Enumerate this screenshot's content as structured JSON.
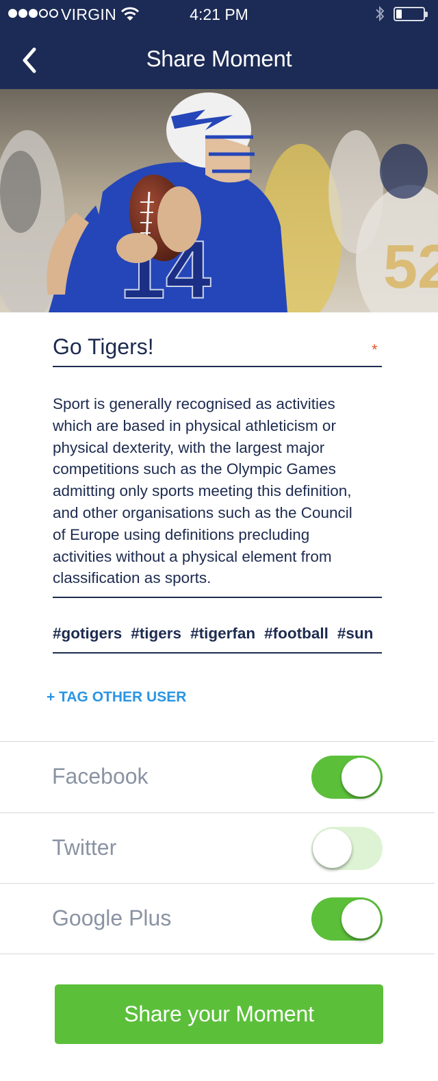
{
  "status_bar": {
    "carrier": "VIRGIN",
    "time": "4:21 PM",
    "signal_bars": 3,
    "signal_total": 5,
    "battery_level": 0.2
  },
  "nav": {
    "title": "Share Moment",
    "back_icon": "chevron-left-icon"
  },
  "hero": {
    "jersey_number": "14"
  },
  "form": {
    "title_value": "Go Tigers!",
    "required_mark": "*",
    "description": "Sport is generally recognised as activities which are based in physical athleticism or physical dexterity, with the largest major competitions such as the Olympic Games admitting only sports meeting this definition, and other organisations such as the Council of Europe using definitions precluding activities without a physical element from classification as sports.",
    "description_lines": [
      "Sport is generally recognised as activities",
      "which are based in physical athleticism or",
      "physical dexterity, with the largest major",
      "competitions such as the Olympic Games",
      "admitting only sports meeting this definition,",
      "and other organisations such as the Council",
      "of Europe using definitions precluding",
      "activities without a physical element from",
      "classification as sports."
    ],
    "tags": [
      "#gotigers",
      "#tigers",
      "#tigerfan",
      "#football",
      "#sun"
    ],
    "tag_user_label": "+ TAG OTHER USER"
  },
  "share": {
    "rows": [
      {
        "label": "Facebook",
        "enabled": true
      },
      {
        "label": "Twitter",
        "enabled": false
      },
      {
        "label": "Google Plus",
        "enabled": true
      }
    ],
    "button_label": "Share your Moment"
  },
  "colors": {
    "header_bg": "#1c2b55",
    "accent_green": "#5bbf3a",
    "link_blue": "#2b95e4",
    "required_red": "#e3562a",
    "text_dark": "#1d2b4f",
    "label_gray": "#8a93a3"
  }
}
